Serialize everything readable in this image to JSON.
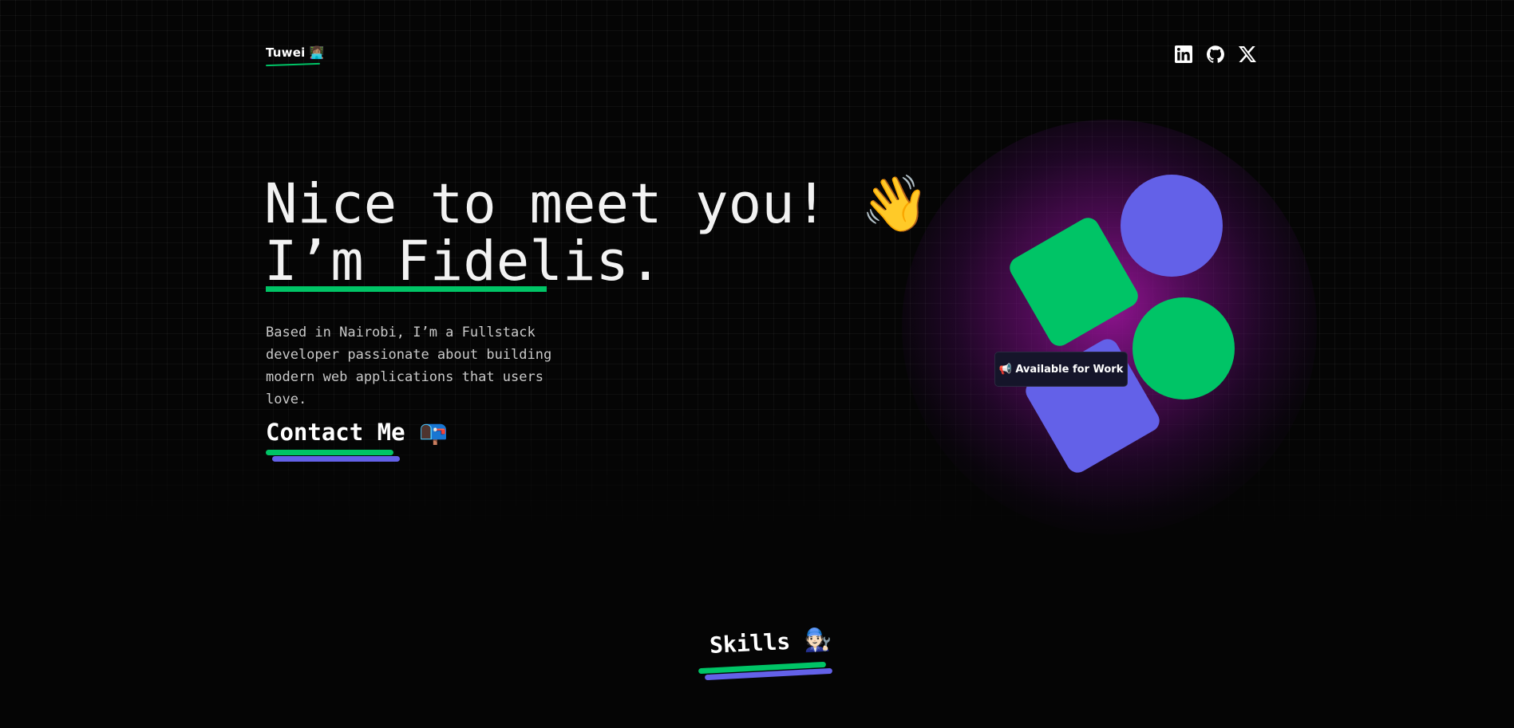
{
  "header": {
    "logo_text": "Tuwei 👩🏽‍💻",
    "social": [
      {
        "icon": "linkedin-icon"
      },
      {
        "icon": "github-icon"
      },
      {
        "icon": "x-icon"
      }
    ]
  },
  "hero": {
    "line1": "Nice to meet you! 👋",
    "line2": "I’m Fidelis.",
    "intro": "Based in Nairobi, I’m a Fullstack developer passionate about building modern web applications that users love.",
    "contact_label": "Contact Me 📭"
  },
  "illustration": {
    "badge_text": "📢 Available for Work"
  },
  "skills": {
    "title": "Skills 🧑🏻‍🔧"
  },
  "colors": {
    "accent_green": "#00c466",
    "accent_purple": "#6361e8",
    "glow_magenta": "#961496",
    "background": "#050505"
  }
}
